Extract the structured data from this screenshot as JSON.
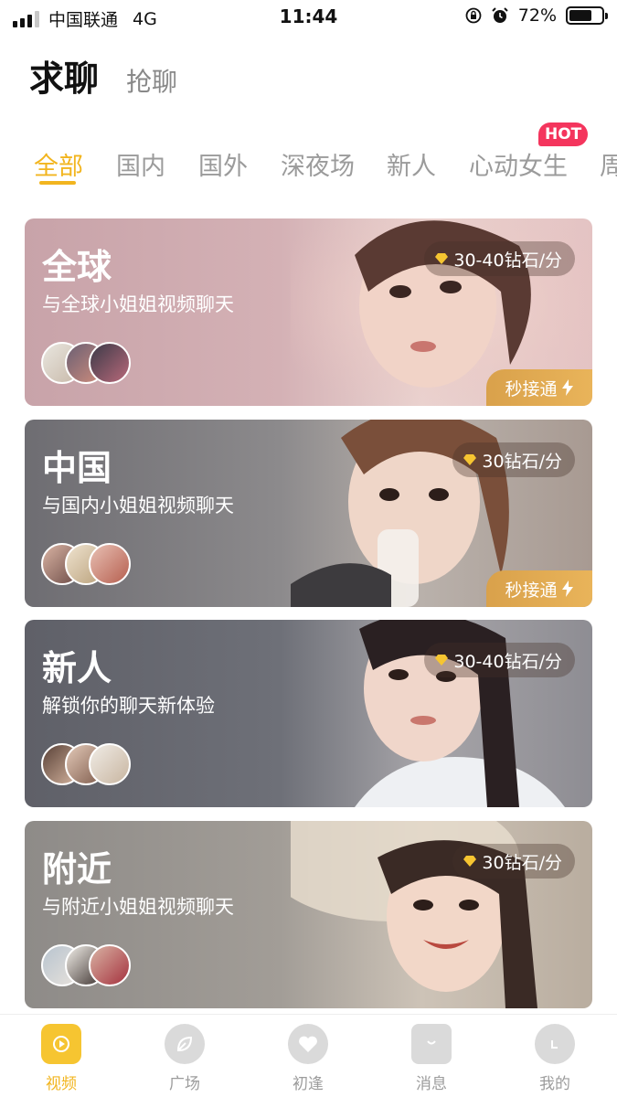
{
  "status_bar": {
    "carrier": "中国联通",
    "network": "4G",
    "time": "11:44",
    "battery": "72%",
    "battery_level": 0.72
  },
  "header": {
    "title": "求聊",
    "secondary": "抢聊"
  },
  "tabs": [
    {
      "label": "全部",
      "active": true
    },
    {
      "label": "国内",
      "active": false
    },
    {
      "label": "国外",
      "active": false
    },
    {
      "label": "深夜场",
      "active": false
    },
    {
      "label": "新人",
      "active": false
    },
    {
      "label": "心动女生",
      "active": false,
      "badge": "HOT"
    },
    {
      "label": "周",
      "active": false
    }
  ],
  "cards": [
    {
      "title": "全球",
      "subtitle": "与全球小姐姐视频聊天",
      "price": "30-40钻石/分",
      "quick": "秒接通"
    },
    {
      "title": "中国",
      "subtitle": "与国内小姐姐视频聊天",
      "price": "30钻石/分",
      "quick": "秒接通"
    },
    {
      "title": "新人",
      "subtitle": "解锁你的聊天新体验",
      "price": "30-40钻石/分"
    },
    {
      "title": "附近",
      "subtitle": "与附近小姐姐视频聊天",
      "price": "30钻石/分"
    }
  ],
  "bottom_nav": [
    {
      "label": "视频",
      "icon": "video-play-icon",
      "active": true
    },
    {
      "label": "广场",
      "icon": "leaf-icon",
      "active": false
    },
    {
      "label": "初逢",
      "icon": "heart-icon",
      "active": false
    },
    {
      "label": "消息",
      "icon": "message-icon",
      "active": false
    },
    {
      "label": "我的",
      "icon": "profile-icon",
      "active": false
    }
  ],
  "colors": {
    "accent": "#f2b51f",
    "hot": "#f4355d",
    "quick_button": "#e0a952"
  }
}
